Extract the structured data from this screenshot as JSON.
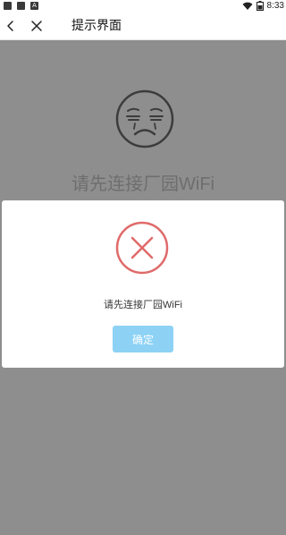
{
  "status_bar": {
    "time": "8:33",
    "left_icons": [
      "gallery-icon",
      "image-icon",
      "font-icon"
    ],
    "right_icons": [
      "wifi-icon",
      "battery-icon"
    ],
    "font_icon_glyph": "A"
  },
  "header": {
    "title": "提示界面",
    "back_icon": "back-arrow-icon",
    "close_icon": "close-icon"
  },
  "background": {
    "face_icon": "crying-face-icon",
    "message": "请先连接厂园WiFi"
  },
  "dialog": {
    "icon": "error-circle-x-icon",
    "message": "请先连接厂园WiFi",
    "confirm_label": "确定"
  },
  "colors": {
    "overlay": "#8e8e8e",
    "error_red": "#e06a6a",
    "confirm_button": "#8dd2f5"
  }
}
